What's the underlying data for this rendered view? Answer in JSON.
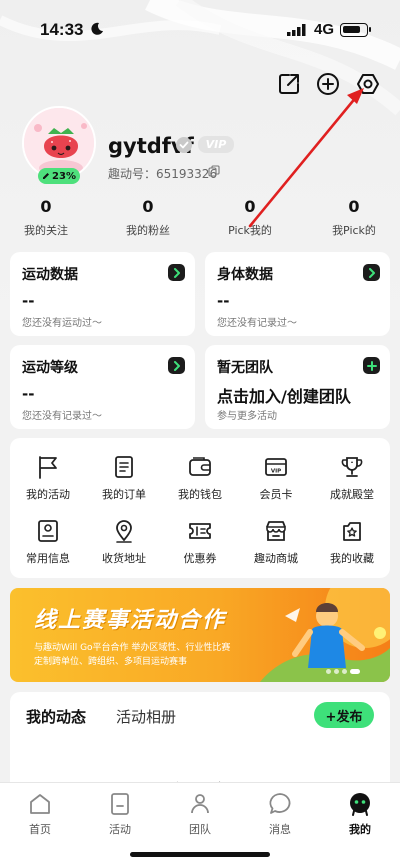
{
  "status_bar": {
    "time": "14:33",
    "network": "4G"
  },
  "profile": {
    "username": "gytdfvf",
    "vip_label": "VIP",
    "user_id": "趣动号：65193326",
    "progress_label": "23%"
  },
  "stats": [
    {
      "value": "0",
      "label": "我的关注"
    },
    {
      "value": "0",
      "label": "我的粉丝"
    },
    {
      "value": "0",
      "label": "Pick我的"
    },
    {
      "value": "0",
      "label": "我Pick的"
    }
  ],
  "cards": {
    "sport_data": {
      "title": "运动数据",
      "value": "--",
      "sub": "您还没有运动过～"
    },
    "body_data": {
      "title": "身体数据",
      "value": "--",
      "sub": "您还没有记录过～"
    },
    "sport_level": {
      "title": "运动等级",
      "value": "--",
      "sub": "您还没有记录过～"
    },
    "team": {
      "title": "暂无团队",
      "value": "点击加入/创建团队",
      "sub": "参与更多活动"
    }
  },
  "grid": [
    {
      "label": "我的活动",
      "icon": "flag-icon"
    },
    {
      "label": "我的订单",
      "icon": "order-icon"
    },
    {
      "label": "我的钱包",
      "icon": "wallet-icon"
    },
    {
      "label": "会员卡",
      "icon": "vip-card-icon"
    },
    {
      "label": "成就殿堂",
      "icon": "trophy-icon"
    },
    {
      "label": "常用信息",
      "icon": "id-card-icon"
    },
    {
      "label": "收货地址",
      "icon": "location-icon"
    },
    {
      "label": "优惠券",
      "icon": "coupon-icon"
    },
    {
      "label": "趣动商城",
      "icon": "store-icon"
    },
    {
      "label": "我的收藏",
      "icon": "favorites-icon"
    }
  ],
  "banner": {
    "title": "线上赛事活动合作",
    "desc1": "与趣动Will Go平台合作 举办区域性、行业性比赛",
    "desc2": "定制跨单位、跨组织、多项目运动赛事"
  },
  "feed": {
    "tab_active": "我的动态",
    "tab_other": "活动相册",
    "publish": "+发布",
    "empty": "暂无动态"
  },
  "tabbar": [
    {
      "label": "首页",
      "icon": "home-icon"
    },
    {
      "label": "活动",
      "icon": "activity-icon"
    },
    {
      "label": "团队",
      "icon": "team-icon"
    },
    {
      "label": "消息",
      "icon": "message-icon"
    },
    {
      "label": "我的",
      "icon": "profile-icon"
    }
  ],
  "colors": {
    "accent": "#3ee07a",
    "annotation_arrow": "#e02020"
  }
}
